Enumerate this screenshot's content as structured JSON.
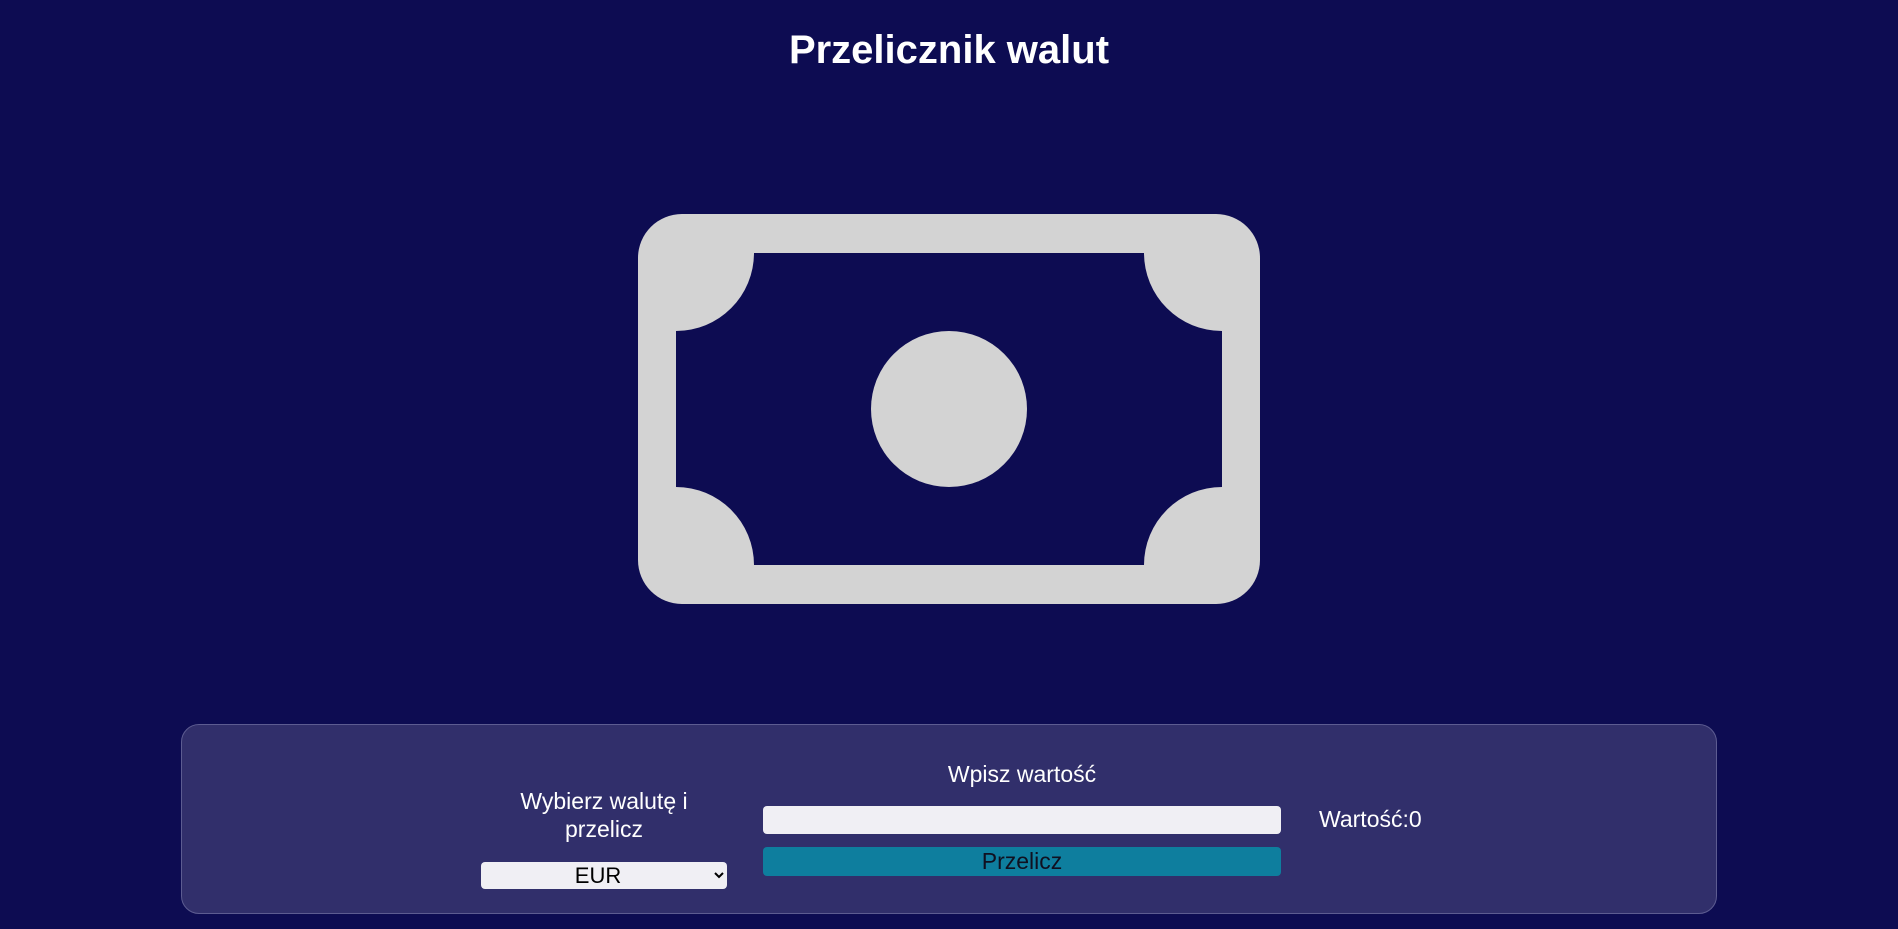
{
  "page": {
    "title": "Przelicznik walut"
  },
  "hero": {
    "icon": "banknote-icon"
  },
  "converter": {
    "select_label": "Wybierz walutę i przelicz",
    "currency_options": [
      "EUR"
    ],
    "selected_currency": "EUR",
    "amount_label": "Wpisz wartość",
    "amount_value": "",
    "convert_label": "Przelicz",
    "result_label": "Wartość:",
    "result_value": "0"
  },
  "colors": {
    "background": "#0d0c52",
    "panel": "#312f6b",
    "icon": "#d3d3d3",
    "button": "#0e7e9e"
  }
}
